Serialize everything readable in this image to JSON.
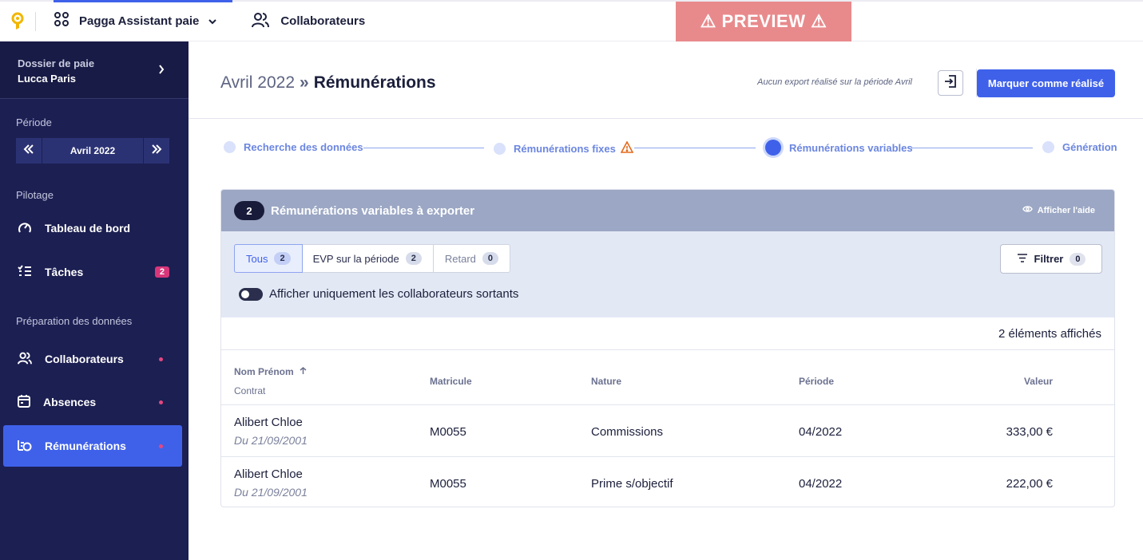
{
  "topbar": {
    "app_name": "Pagga Assistant paie",
    "nav_collaborateurs": "Collaborateurs",
    "preview": "⚠ PREVIEW ⚠"
  },
  "sidebar": {
    "folder_caption": "Dossier de paie",
    "folder_name": "Lucca Paris",
    "period_label": "Période",
    "period_value": "Avril 2022",
    "pilotage_label": "Pilotage",
    "items_pilotage": [
      {
        "label": "Tableau de bord"
      },
      {
        "label": "Tâches",
        "badge": "2"
      }
    ],
    "prep_label": "Préparation des données",
    "items_prep": [
      {
        "label": "Collaborateurs"
      },
      {
        "label": "Absences"
      },
      {
        "label": "Rémunérations"
      }
    ]
  },
  "header": {
    "crumb_parent": "Avril 2022",
    "crumb_sep": "»",
    "crumb_current": "Rémunérations",
    "export_info": "Aucun export réalisé sur la période Avril",
    "done_label": "Marquer comme réalisé"
  },
  "stepper": {
    "steps": [
      {
        "label": "Recherche des données"
      },
      {
        "label": "Rémunérations fixes"
      },
      {
        "label": "Rémunérations variables"
      },
      {
        "label": "Génération"
      }
    ]
  },
  "panel": {
    "count": "2",
    "title": "Rémunérations variables à exporter",
    "help_label": "Afficher l'aide",
    "tabs": [
      {
        "label": "Tous",
        "count": "2"
      },
      {
        "label": "EVP sur la période",
        "count": "2"
      },
      {
        "label": "Retard",
        "count": "0"
      }
    ],
    "filter_label": "Filtrer",
    "filter_count": "0",
    "toggle_label": "Afficher uniquement les collaborateurs sortants",
    "items_count": "2 éléments affichés",
    "columns": {
      "name": "Nom Prénom",
      "contract": "Contrat",
      "matricule": "Matricule",
      "nature": "Nature",
      "periode": "Période",
      "valeur": "Valeur"
    },
    "rows": [
      {
        "name": "Alibert Chloe",
        "contract": "Du 21/09/2001",
        "matricule": "M0055",
        "nature": "Commissions",
        "periode": "04/2022",
        "valeur": "333,00 €"
      },
      {
        "name": "Alibert Chloe",
        "contract": "Du 21/09/2001",
        "matricule": "M0055",
        "nature": "Prime s/objectif",
        "periode": "04/2022",
        "valeur": "222,00 €"
      }
    ]
  },
  "colors": {
    "accent": "#3f61ea",
    "sidebar_bg": "#1c1f52",
    "warning": "#e36b1d",
    "preview_bg": "#e88a8c"
  }
}
